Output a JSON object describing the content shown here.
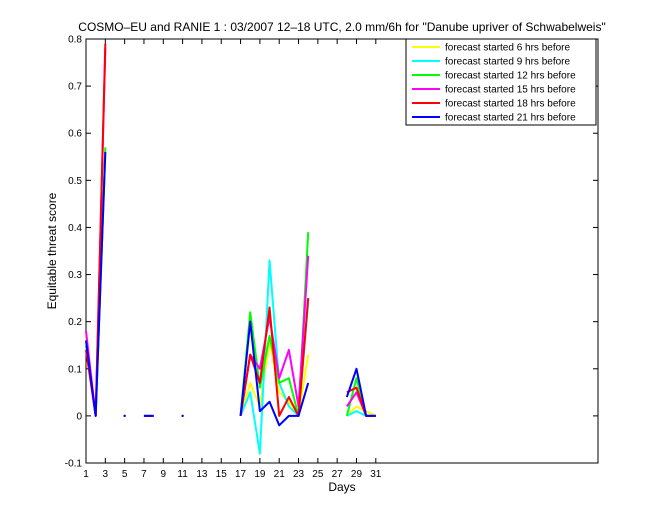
{
  "chart_data": {
    "type": "line",
    "title": "COSMO–EU and RANIE 1 : 03/2007 12–18 UTC, 2.0 mm/6h for \"Danube upriver of Schwabelweis\"",
    "xlabel": "Days",
    "ylabel": "Equitable threat score",
    "xlim": [
      1,
      54
    ],
    "ylim": [
      -0.1,
      0.8
    ],
    "xticks": [
      1,
      3,
      5,
      7,
      9,
      11,
      13,
      15,
      17,
      19,
      21,
      23,
      25,
      27,
      29,
      31
    ],
    "yticks": [
      -0.1,
      0,
      0.1,
      0.2,
      0.3,
      0.4,
      0.5,
      0.6,
      0.7,
      0.8
    ],
    "grid": false,
    "legend_position": "top-right",
    "x": [
      1,
      2,
      3,
      4,
      5,
      6,
      7,
      8,
      9,
      10,
      11,
      12,
      13,
      14,
      15,
      16,
      17,
      18,
      19,
      20,
      21,
      22,
      23,
      24,
      25,
      26,
      27,
      28,
      29,
      30,
      31
    ],
    "series": [
      {
        "name": "forecast started 6 hrs before",
        "color": "#ffff00",
        "values": [
          0.17,
          0.0,
          0.56,
          null,
          0.0,
          null,
          0.0,
          0.0,
          null,
          null,
          0.0,
          null,
          null,
          null,
          null,
          null,
          0.0,
          0.07,
          0.02,
          0.16,
          0.05,
          0.03,
          0.0,
          0.13,
          null,
          null,
          null,
          0.0,
          0.02,
          0.01,
          0.0
        ]
      },
      {
        "name": "forecast started 9 hrs before",
        "color": "#00ffff",
        "values": [
          0.16,
          0.0,
          0.56,
          null,
          0.0,
          null,
          0.0,
          0.0,
          null,
          null,
          0.0,
          null,
          null,
          null,
          null,
          null,
          0.0,
          0.05,
          -0.08,
          0.33,
          0.07,
          0.02,
          0.0,
          0.24,
          null,
          null,
          null,
          0.0,
          0.01,
          0.0,
          0.0
        ]
      },
      {
        "name": "forecast started 12 hrs before",
        "color": "#00ff00",
        "values": [
          0.15,
          0.0,
          0.57,
          null,
          0.0,
          null,
          0.0,
          0.0,
          null,
          null,
          0.0,
          null,
          null,
          null,
          null,
          null,
          0.0,
          0.22,
          0.06,
          0.17,
          0.07,
          0.08,
          0.0,
          0.39,
          null,
          null,
          null,
          0.0,
          0.08,
          0.0,
          0.0
        ]
      },
      {
        "name": "forecast started 15 hrs before",
        "color": "#ff00ff",
        "values": [
          0.18,
          0.0,
          0.78,
          null,
          0.0,
          null,
          0.0,
          0.0,
          null,
          null,
          0.0,
          null,
          null,
          null,
          null,
          null,
          0.0,
          0.13,
          0.1,
          0.21,
          0.08,
          0.14,
          0.02,
          0.34,
          null,
          null,
          null,
          0.02,
          0.05,
          0.0,
          0.0
        ]
      },
      {
        "name": "forecast started 18 hrs before",
        "color": "#ff0000",
        "values": [
          0.14,
          0.0,
          0.79,
          null,
          0.0,
          null,
          0.0,
          0.0,
          null,
          null,
          0.0,
          null,
          null,
          null,
          null,
          null,
          0.0,
          0.13,
          0.07,
          0.23,
          0.0,
          0.04,
          0.0,
          0.25,
          null,
          null,
          null,
          0.05,
          0.06,
          0.0,
          0.0
        ]
      },
      {
        "name": "forecast started 21 hrs before",
        "color": "#0000ff",
        "values": [
          0.16,
          0.0,
          0.56,
          null,
          0.0,
          null,
          0.0,
          0.0,
          null,
          null,
          0.0,
          null,
          null,
          null,
          null,
          null,
          0.0,
          0.2,
          0.01,
          0.03,
          -0.02,
          0.0,
          0.0,
          0.07,
          null,
          null,
          null,
          0.04,
          0.1,
          0.0,
          0.0
        ]
      }
    ]
  }
}
